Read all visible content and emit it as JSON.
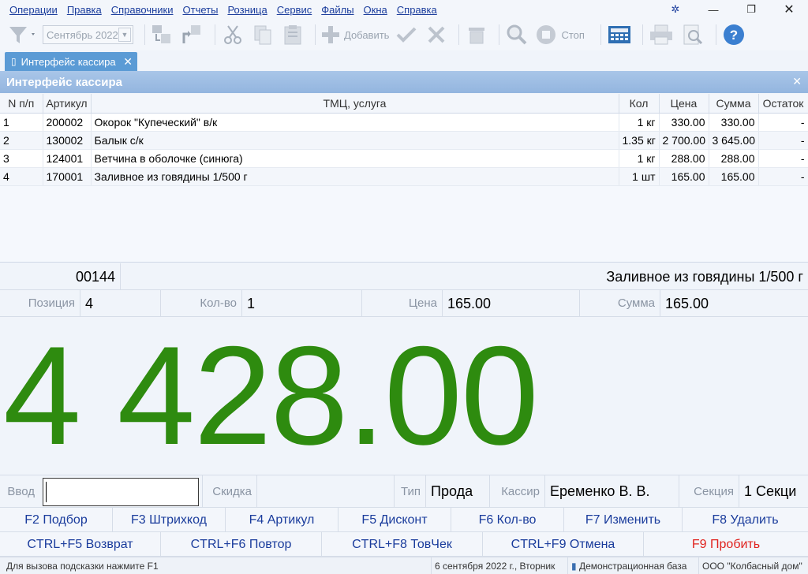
{
  "menu": {
    "items": [
      "Операции",
      "Правка",
      "Справочники",
      "Отчеты",
      "Розница",
      "Сервис",
      "Файлы",
      "Окна",
      "Справка"
    ]
  },
  "toolbar": {
    "month_value": "Сентябрь 2022",
    "add_label": "Добавить",
    "stop_label": "Стоп"
  },
  "tab": {
    "label": "Интерфейс кассира"
  },
  "window": {
    "title": "Интерфейс кассира"
  },
  "table": {
    "headers": [
      "N п/п",
      "Артикул",
      "ТМЦ, услуга",
      "Кол",
      "Цена",
      "Сумма",
      "Остаток"
    ],
    "rows": [
      {
        "n": "1",
        "article": "200002",
        "name": "Окорок \"Купеческий\" в/к",
        "qty": "1 кг",
        "price": "330.00",
        "sum": "330.00",
        "rest": "-"
      },
      {
        "n": "2",
        "article": "130002",
        "name": "Балык с/к",
        "qty": "1.35 кг",
        "price": "2 700.00",
        "sum": "3 645.00",
        "rest": "-"
      },
      {
        "n": "3",
        "article": "124001",
        "name": "Ветчина в оболочке (синюга)",
        "qty": "1 кг",
        "price": "288.00",
        "sum": "288.00",
        "rest": "-"
      },
      {
        "n": "4",
        "article": "170001",
        "name": "Заливное из говядины 1/500 г",
        "qty": "1 шт",
        "price": "165.00",
        "sum": "165.00",
        "rest": "-"
      }
    ]
  },
  "current": {
    "code": "00144",
    "name": "Заливное из говядины 1/500 г",
    "position_label": "Позиция",
    "position": "4",
    "qty_label": "Кол-во",
    "qty": "1",
    "price_label": "Цена",
    "price": "165.00",
    "sum_label": "Сумма",
    "sum": "165.00"
  },
  "total": {
    "amount": "4 428.00"
  },
  "entry": {
    "input_label": "Ввод",
    "input_value": "",
    "discount_label": "Скидка",
    "type_label": "Тип",
    "type_value": "Прода",
    "cashier_label": "Кассир",
    "cashier_value": "Еременко В. В.",
    "section_label": "Секция",
    "section_value": "1 Секци"
  },
  "fkeys_row1": [
    "F2 Подбор",
    "F3 Штрихкод",
    "F4 Артикул",
    "F5 Дисконт",
    "F6 Кол-во",
    "F7 Изменить",
    "F8 Удалить"
  ],
  "fkeys_row2": [
    "CTRL+F5 Возврат",
    "CTRL+F6 Повтор",
    "CTRL+F8 ТовЧек",
    "CTRL+F9 Отмена",
    "F9 Пробить"
  ],
  "status": {
    "hint": "Для вызова подсказки нажмите F1",
    "date": "6 сентября 2022 г., Вторник",
    "db": "Демонстрационная база",
    "org": "ООО \"Колбасный дом\""
  },
  "colors": {
    "total": "#2e8b0f",
    "accent": "#5b9bd5",
    "link": "#1a3c9c",
    "danger": "#e0211d"
  }
}
